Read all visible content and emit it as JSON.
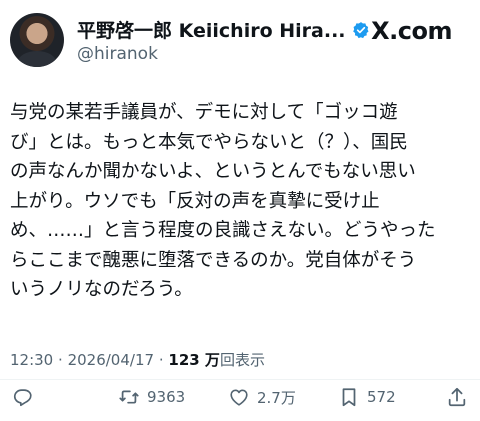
{
  "author": {
    "display_name": "平野啓一郎 Keiichiro Hira...",
    "handle": "@hiranok"
  },
  "brand": {
    "logo_text": "X.com"
  },
  "tweet": {
    "text": "与党の某若手議員が、デモに対して「ゴッコ遊\nび」とは。もっと本気でやらないと（？）、国民\nの声なんか聞かないよ、というとんでもない思い\n上がり。ウソでも「反対の声を真摯に受け止\nめ、……」と言う程度の良識さえない。どうやった\nらここまで醜悪に堕落できるのか。党自体がそう\nいうノリなのだろう。"
  },
  "meta": {
    "time": "12:30",
    "separator": "·",
    "date": "2026/04/17",
    "views_count": "123 万",
    "views_label": "回表示"
  },
  "actions": {
    "reply": {
      "icon": "reply-icon"
    },
    "retweet": {
      "icon": "retweet-icon",
      "count": "9363"
    },
    "like": {
      "icon": "heart-icon",
      "count": "2.7万"
    },
    "bookmark": {
      "icon": "bookmark-icon",
      "count": "572"
    },
    "share": {
      "icon": "share-icon"
    }
  },
  "colors": {
    "text": "#0f1419",
    "secondary": "#536471",
    "verified": "#1d9bf0",
    "divider": "#eff3f4"
  }
}
